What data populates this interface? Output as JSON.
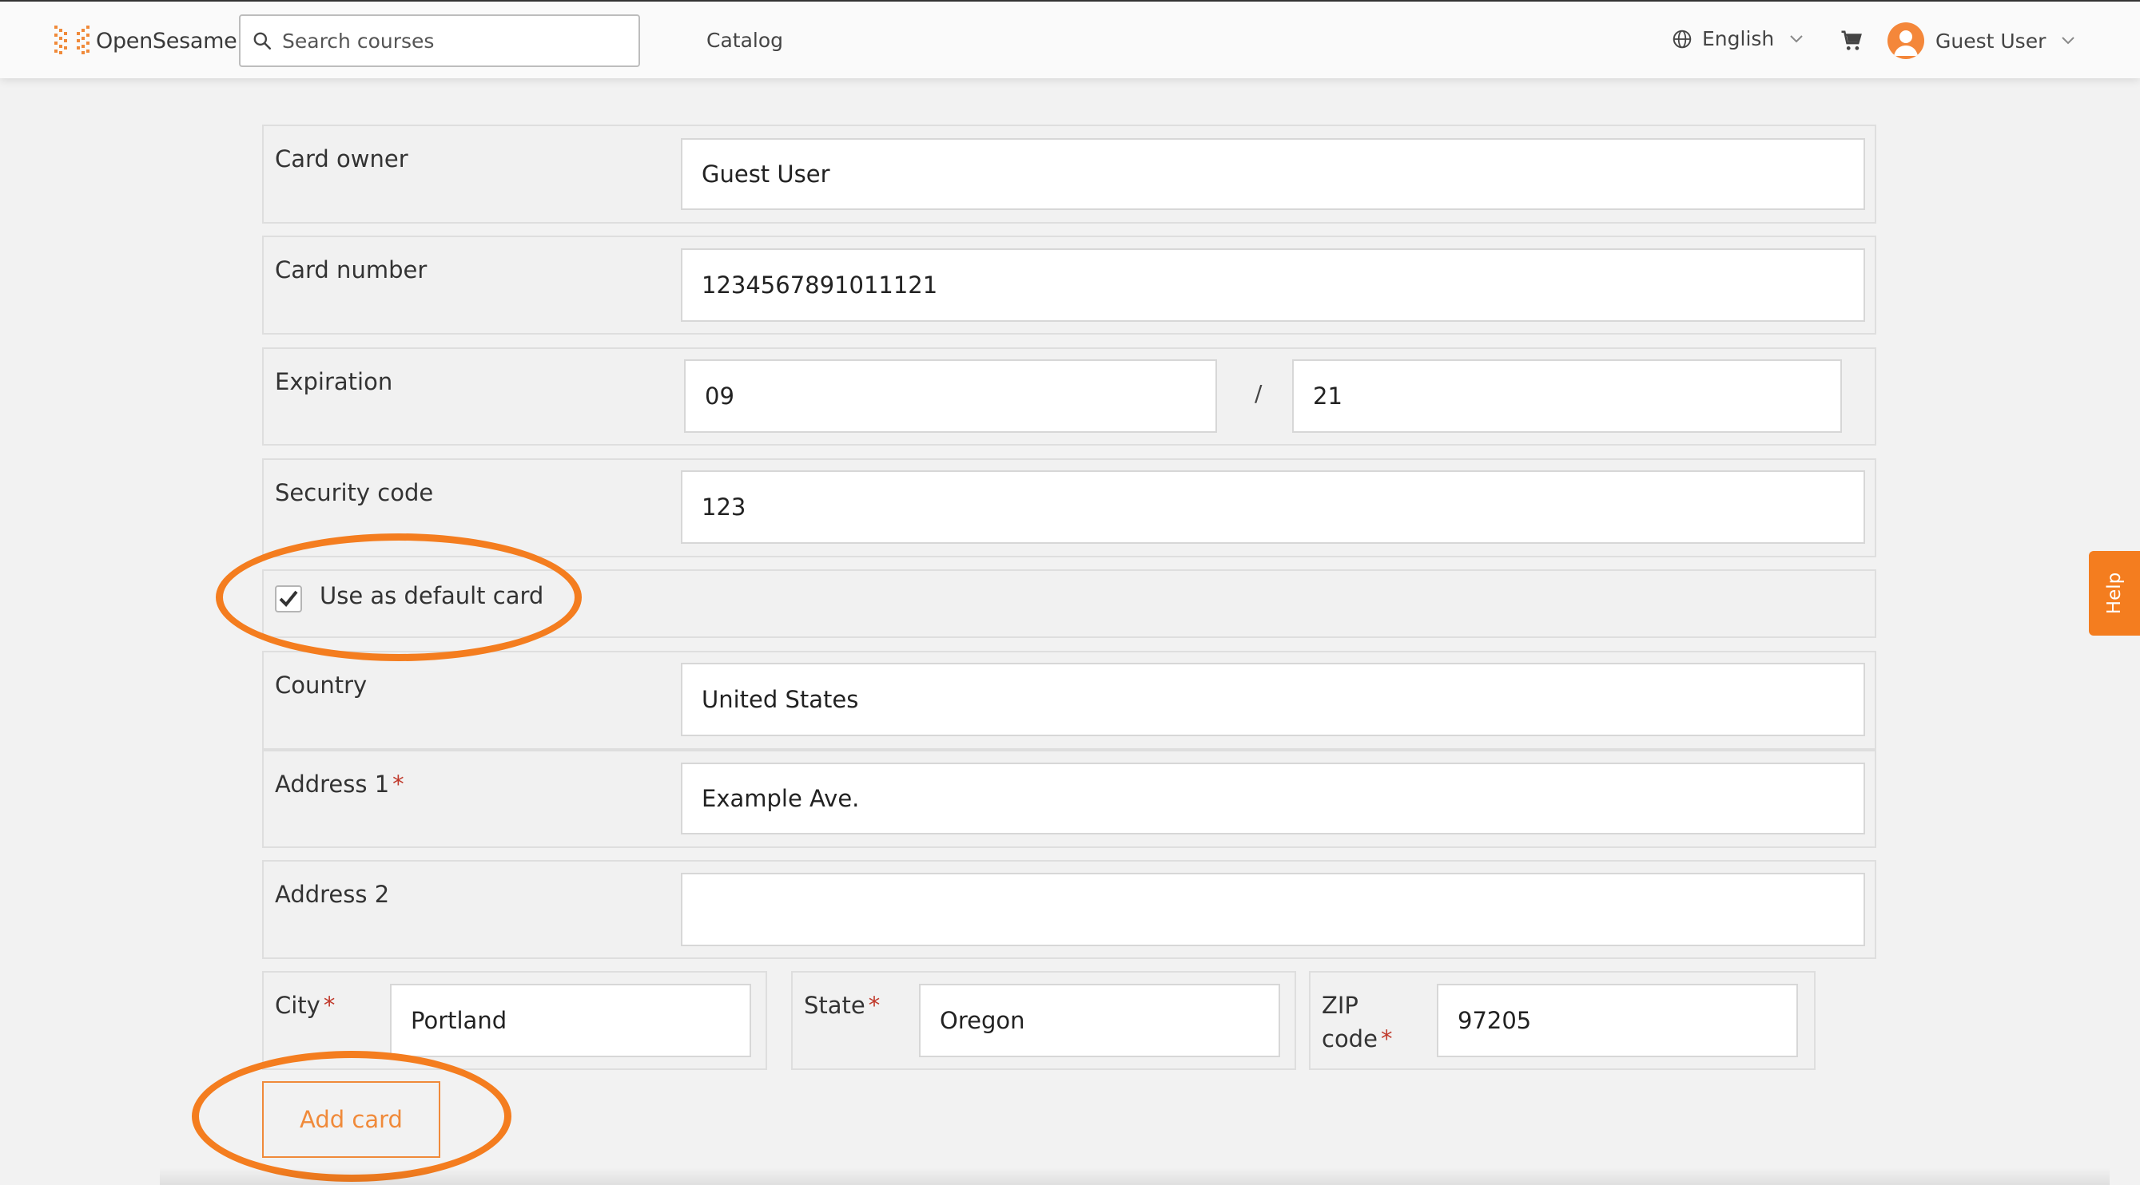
{
  "header": {
    "logo_text": "OpenSesame",
    "search_placeholder": "Search courses",
    "catalog": "Catalog",
    "language": "English",
    "user_name": "Guest User"
  },
  "form": {
    "card_owner": {
      "label": "Card owner",
      "value": "Guest User"
    },
    "card_number": {
      "label": "Card number",
      "value": "1234567891011121"
    },
    "expiration": {
      "label": "Expiration",
      "month": "09",
      "separator": "/",
      "year": "21"
    },
    "security_code": {
      "label": "Security code",
      "value": "123"
    },
    "default_card": {
      "label": "Use as default card",
      "checked": true
    },
    "country": {
      "label": "Country",
      "value": "United States"
    },
    "address1": {
      "label": "Address 1",
      "required_mark": "*",
      "value": "Example Ave."
    },
    "address2": {
      "label": "Address 2",
      "value": ""
    },
    "city": {
      "label": "City",
      "required_mark": "*",
      "value": "Portland"
    },
    "state": {
      "label": "State",
      "required_mark": "*",
      "value": "Oregon"
    },
    "zip": {
      "label_line1": "ZIP",
      "label_line2": "code",
      "required_mark": "*",
      "value": "97205"
    },
    "add_button": "Add card"
  },
  "help_tab": "Help",
  "colors": {
    "accent": "#f47d1f",
    "required": "#c0392b"
  }
}
